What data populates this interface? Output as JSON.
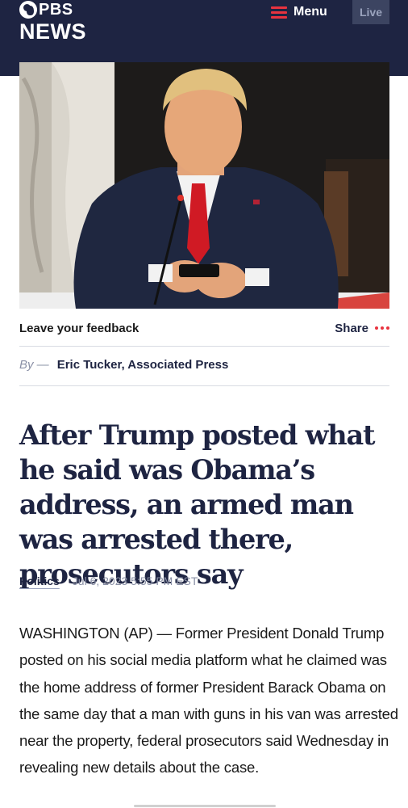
{
  "header": {
    "logo_top": "PBS",
    "logo_bottom": "NEWS",
    "menu_label": "Menu",
    "live_label": "Live",
    "background_color": "#1e2442",
    "accent_color": "#e8333f"
  },
  "hero_image": {
    "icon": "article-photo"
  },
  "utility_bar": {
    "feedback_label": "Leave your feedback",
    "share_label": "Share",
    "more_icon": "more-dots-icon"
  },
  "byline": {
    "prefix": "By —",
    "author": "Eric Tucker, Associated Press"
  },
  "article": {
    "headline": "After Trump posted what he said was Obama’s address, an armed man was arrested there, prosecutors say",
    "category": "Politics",
    "timestamp": "Jul 6, 2023 5:55 PM EST",
    "body": "WASHINGTON (AP) — Former President Donald Trump posted on his social media platform what he claimed was the home address of former President Barack Obama on the same day that a man with guns in his van was arrested near the property, federal prosecutors said Wednesday in revealing new details about the case."
  }
}
